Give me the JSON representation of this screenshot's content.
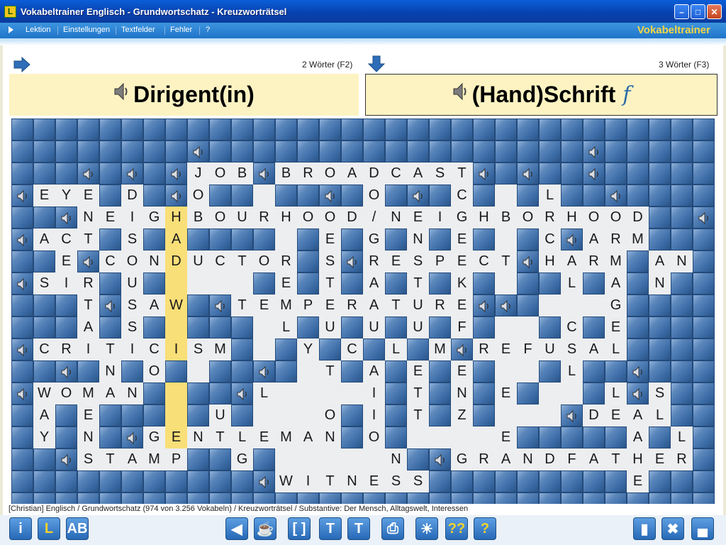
{
  "window": {
    "title": "Vokabeltrainer Englisch - Grundwortschatz - Kreuzworträtsel",
    "app_icon_glyph": "L",
    "minimize_glyph": "–",
    "maximize_glyph": "□",
    "close_glyph": "✕"
  },
  "menu": {
    "items": [
      "Lektion",
      "Einstellungen",
      "Textfelder",
      "Fehler",
      "?"
    ],
    "brand": "Vokabeltrainer"
  },
  "clues": {
    "across": {
      "count": "2 Wörter (F2)",
      "word": "Dirigent(in)",
      "gender": ""
    },
    "down": {
      "count": "3 Wörter (F3)",
      "word": "(Hand)Schrift",
      "gender": "f"
    }
  },
  "grid_rows": [
    "################################",
    "########!#################!#####",
    "###!#!#!JOB!BROADCAST!#!##!#####",
    "!EYE#D#!O##.##!#O#!#C#.#L##!####",
    "##!NEIGHBOURHOOD/NEIGHBORHOOD##!",
    "!ACT#S#A####.#E#G#N#E#.#C!ARM#",
    "##E!CONDUCTOR#S!RESPECT!HARM#AN",
    "!SIR#U#....#E#T#A#T#K#.##L#A#N#",
    "###T!SAW#!TEMPERATURE!!#...G#",
    "###A#S#.###.L#U#U#U#F#..#C#E##",
    "!CRITICISM#.#Y#C#L#M!REFUSAL##",
    "##!#N#O#.##!#.T#A#E#E#..#L##!#",
    "!WOMAN#.##!L....I#T#N#E#..#L!S#",
    "#A#E###.#U#...O#I#T#Z#...!DEAL",
    "#Y#N#!GENTLEMAN#O#....E#####A#L#",
    "##!STAMP##G#.....N#!GRANDFATHER",
    "###########!WITNESS#########E###",
    "################################"
  ],
  "highlight_cells": [
    [
      4,
      7
    ],
    [
      5,
      7
    ],
    [
      6,
      7
    ],
    [
      7,
      7
    ],
    [
      8,
      7
    ],
    [
      9,
      7
    ],
    [
      10,
      7
    ],
    [
      11,
      7
    ],
    [
      12,
      7
    ],
    [
      13,
      7
    ],
    [
      14,
      7
    ]
  ],
  "statusbar": "[Christian]  Englisch / Grundwortschatz  (974 von 3.256 Vokabeln) / Kreuzworträtsel / Substantive: Der Mensch, Alltagswelt, Interessen",
  "toolbar": {
    "left": [
      {
        "name": "info-button",
        "glyph": "i"
      },
      {
        "name": "lesson-button",
        "glyph": "L"
      },
      {
        "name": "ab-button",
        "glyph": "AB"
      }
    ],
    "center": [
      {
        "name": "back-button",
        "glyph": "◀"
      },
      {
        "name": "break-button",
        "glyph": "☕"
      },
      {
        "name": "bracket-button",
        "glyph": "[ ]"
      },
      {
        "name": "text-button-1",
        "glyph": "T"
      },
      {
        "name": "text-button-2",
        "glyph": "T"
      },
      {
        "name": "print-button",
        "glyph": "⎙"
      },
      {
        "name": "hint-button",
        "glyph": "☀"
      },
      {
        "name": "double-help-button",
        "glyph": "??"
      },
      {
        "name": "help-button",
        "glyph": "?"
      }
    ],
    "right": [
      {
        "name": "book-button",
        "glyph": "▮"
      },
      {
        "name": "shrink-button",
        "glyph": "✖"
      },
      {
        "name": "stats-button",
        "glyph": "▄"
      }
    ]
  }
}
